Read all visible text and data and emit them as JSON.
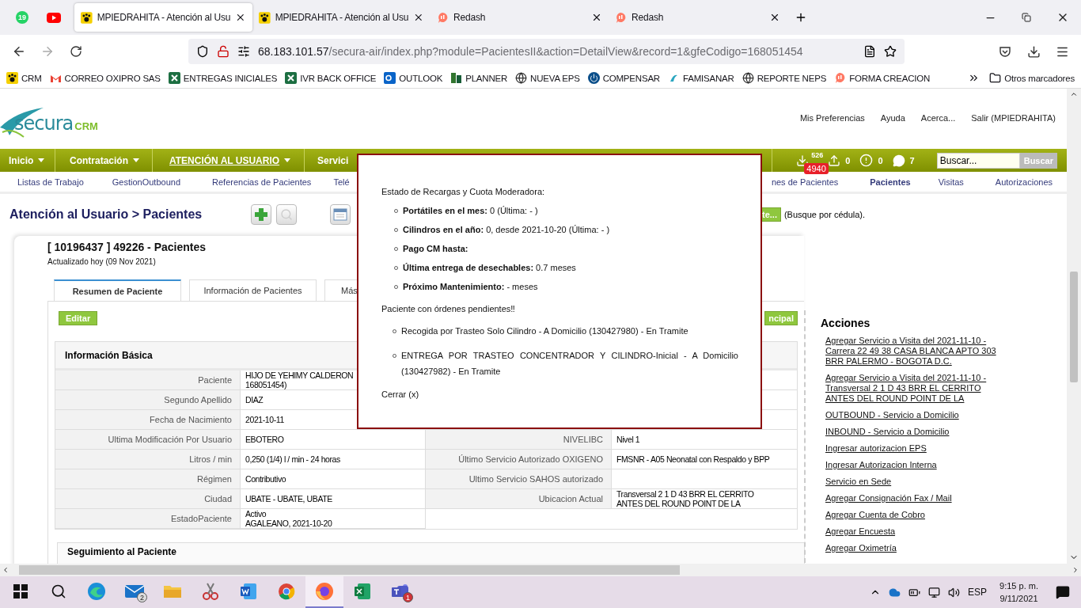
{
  "browser": {
    "pinned_tabs": [
      {
        "kind": "whatsapp",
        "badge": "19"
      },
      {
        "kind": "youtube"
      }
    ],
    "tabs": [
      {
        "title": "MPIEDRAHITA - Atención al Usu",
        "kind": "crm",
        "selected": true
      },
      {
        "title": "MPIEDRAHITA - Atención al Usu",
        "kind": "crm",
        "selected": false
      },
      {
        "title": "Redash",
        "kind": "redash",
        "selected": false
      },
      {
        "title": "Redash",
        "kind": "redash",
        "selected": false
      }
    ],
    "url_host": "68.183.101.57",
    "url_path": "/secura-air/index.php?module=PacientesII&action=DetailView&record=1&gfeCodigo=168051454",
    "bookmarks": [
      {
        "label": "CRM",
        "kind": "crm"
      },
      {
        "label": "CORREO OXIPRO SAS",
        "kind": "gmail"
      },
      {
        "label": "ENTREGAS INICIALES",
        "kind": "excel"
      },
      {
        "label": "IVR BACK OFFICE",
        "kind": "excel"
      },
      {
        "label": "OUTLOOK",
        "kind": "outlook"
      },
      {
        "label": "PLANNER",
        "kind": "planner"
      },
      {
        "label": "NUEVA EPS",
        "kind": "globe"
      },
      {
        "label": "COMPENSAR",
        "kind": "power"
      },
      {
        "label": "FAMISANAR",
        "kind": "famisanar"
      },
      {
        "label": "REPORTE NEPS",
        "kind": "globe"
      },
      {
        "label": "FORMA CREACION",
        "kind": "redash"
      }
    ],
    "other_bookmarks": "Otros marcadores"
  },
  "app": {
    "logo": {
      "brand": "secura",
      "suffix": "CRM"
    },
    "header_links": [
      "Mis Preferencias",
      "Ayuda",
      "Acerca...",
      "Salir (MPIEDRAHITA)"
    ],
    "nav": [
      {
        "label": "Inicio",
        "caret": true,
        "selected": false
      },
      {
        "label": "Contratación",
        "caret": true,
        "selected": false
      },
      {
        "label": "ATENCIÓN AL USUARIO",
        "caret": true,
        "selected": true
      },
      {
        "label": "Servici",
        "caret": false,
        "selected": false
      }
    ],
    "counters": {
      "inbox": "526",
      "inbox_badge": "4940",
      "outbox": "0",
      "alerts": "0",
      "messages": "7"
    },
    "search": {
      "placeholder": "Buscar...",
      "button": "Buscar"
    },
    "subnav_left": [
      {
        "label": "Listas de Trabajo",
        "selected": false
      },
      {
        "label": "GestionOutbound",
        "selected": false
      },
      {
        "label": "Referencias de Pacientes",
        "selected": false
      },
      {
        "label": "Telé",
        "selected": false
      }
    ],
    "subnav_right": [
      {
        "label": "nes de Pacientes",
        "selected": false
      },
      {
        "label": "Pacientes",
        "selected": true
      },
      {
        "label": "Visitas",
        "selected": false
      },
      {
        "label": "Autorizaciones",
        "selected": false
      }
    ],
    "breadcrumb": "Atención al Usuario > Pacientes",
    "find_button": "te...",
    "find_hint": "(Busque por cédula).",
    "record": {
      "title": "[ 10196437 ] 49226 - Pacientes",
      "updated": "Actualizado hoy (09 Nov 2021)"
    },
    "record_tabs": [
      {
        "label": "Resumen de Paciente",
        "selected": true
      },
      {
        "label": "Información de Pacientes",
        "selected": false
      },
      {
        "label": "Más",
        "selected": false
      }
    ],
    "edit_button": "Editar",
    "principal_button": "ncipal",
    "basic_info": {
      "title": "Información Básica",
      "left_rows": [
        {
          "label": "Paciente",
          "value": [
            "HIJO DE YEHIMY CALDERON",
            "168051454)"
          ]
        },
        {
          "label": "Segundo Apellido",
          "value": [
            "DIAZ"
          ]
        },
        {
          "label": "Fecha de Nacimiento",
          "value": [
            "2021-10-11"
          ]
        },
        {
          "label": "Ultima Modificación Por Usuario",
          "value": [
            "EBOTERO"
          ]
        },
        {
          "label": "Litros / min",
          "value": [
            "0,250 (1/4) l / min - 24 horas"
          ]
        },
        {
          "label": "Régimen",
          "value": [
            "Contributivo"
          ]
        },
        {
          "label": "Ciudad",
          "value": [
            "UBATE - UBATE, UBATE"
          ]
        },
        {
          "label": "EstadoPaciente",
          "value": [
            "Activo",
            "AGALEANO, 2021-10-20"
          ]
        }
      ],
      "right_rows": [
        {
          "label": "NIVELIBC",
          "value": [
            "Nivel 1"
          ]
        },
        {
          "label": "Último Servicio Autorizado OXIGENO",
          "value": [
            "FMSNR - A05 Neonatal con Respaldo y BPP"
          ]
        },
        {
          "label": "Ultimo Servicio SAHOS autorizado",
          "value": []
        },
        {
          "label": "Ubicacion Actual",
          "value": [
            "Transversal 2 1 D 43 BRR EL CERRITO",
            "ANTES DEL ROUND POINT DE LA"
          ]
        }
      ]
    },
    "follow_up": {
      "title": "Seguimiento al Paciente"
    },
    "actions": {
      "title": "Acciones",
      "links": [
        "Agregar Servicio a Visita del 2021-11-10 - Carrera 22 49 38 CASA BLANCA APTO 303 BRR PALERMO - BOGOTA D.C.",
        "Agregar Servicio a Visita del 2021-11-10 - Transversal 2 1 D 43 BRR EL CERRITO ANTES DEL ROUND POINT DE LA",
        "OUTBOUND - Servicio a Domicilio",
        "INBOUND - Servicio a Domicilio",
        "Ingresar autorizacion EPS",
        "Ingresar Autorizacion Interna",
        "Servicio en Sede",
        "Agregar Consignación Fax / Mail",
        "Agregar Cuenta de Cobro",
        "Agregar Encuesta",
        "Agregar Oximetría"
      ]
    }
  },
  "modal": {
    "title": "Estado de Recargas y Cuota Moderadora:",
    "items": [
      "**Portátiles en el mes:** 0 (Última: - )",
      "**Cilindros en el año:** 0, desde 2021-10-20 (Última: - )",
      "**Pago CM hasta:**",
      "**Última entrega de desechables:** 0.7 meses",
      "**Próximo Mantenimiento:** - meses"
    ],
    "orders_title": "Paciente con órdenes pendientes‼",
    "orders": [
      "Recogida por Trasteo Solo Cilindro - A Domicilio (130427980) - En Tramite",
      "ENTREGA POR TRASTEO CONCENTRADOR Y CILINDRO-Inicial - A Domicilio (130427982) - En Tramite"
    ],
    "close": "Cerrar (x)"
  },
  "taskbar": {
    "apps": [
      {
        "kind": "start",
        "selected": false
      },
      {
        "kind": "search",
        "selected": false
      },
      {
        "kind": "edge",
        "selected": false
      },
      {
        "kind": "mail",
        "badge": "2",
        "selected": false
      },
      {
        "kind": "explorer",
        "selected": false
      },
      {
        "kind": "snip",
        "selected": false
      },
      {
        "kind": "word",
        "selected": false
      },
      {
        "kind": "chrome",
        "selected": false
      },
      {
        "kind": "firefox",
        "selected": true
      },
      {
        "kind": "excel",
        "selected": false
      },
      {
        "kind": "teams",
        "badge": "1",
        "selected": false
      }
    ],
    "language": "ESP",
    "time": "9:15 p. m.",
    "date": "9/11/2021"
  }
}
